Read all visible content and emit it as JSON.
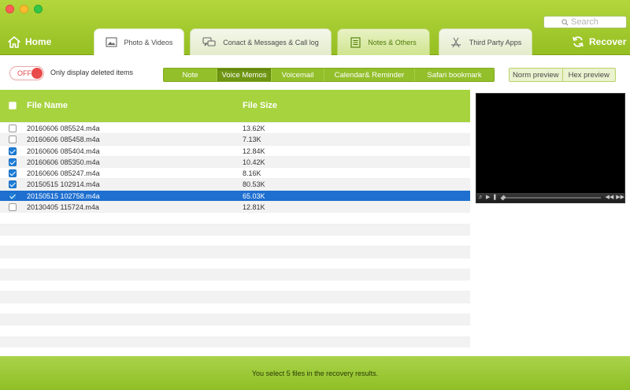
{
  "window": {
    "search_placeholder": "Search"
  },
  "nav": {
    "home_label": "Home",
    "recover_label": "Recover",
    "tabs": [
      {
        "label": "Photo & Videos",
        "icon": "image-icon"
      },
      {
        "label": "Conact & Messages & Call log",
        "icon": "chat-bubbles-icon"
      },
      {
        "label": "Notes & Others",
        "icon": "notes-icon"
      },
      {
        "label": "Third Party Apps",
        "icon": "app-store-icon"
      }
    ]
  },
  "filter": {
    "toggle_label": "OFF",
    "deleted_label": "Only display deleted items",
    "categories": [
      "Note",
      "Voice Memos",
      "Voicemail",
      "Calendar& Reminder",
      "Safari bookmark"
    ],
    "selected_category": "Voice Memos",
    "preview_modes": [
      "Norm preview",
      "Hex preview"
    ]
  },
  "table": {
    "headers": {
      "name": "File Name",
      "size": "File Size"
    },
    "rows": [
      {
        "name": "20160606 085524.m4a",
        "size": "13.62K",
        "checked": false
      },
      {
        "name": "20160606 085458.m4a",
        "size": "7.13K",
        "checked": false
      },
      {
        "name": "20160606 085404.m4a",
        "size": "12.84K",
        "checked": true
      },
      {
        "name": "20160606 085350.m4a",
        "size": "10.42K",
        "checked": true
      },
      {
        "name": "20160606 085247.m4a",
        "size": "8.16K",
        "checked": true
      },
      {
        "name": "20150515 102914.m4a",
        "size": "80.53K",
        "checked": true
      },
      {
        "name": "20150515 102758.m4a",
        "size": "65.03K",
        "checked": true
      },
      {
        "name": "20130405 115724.m4a",
        "size": "12.81K",
        "checked": false
      }
    ],
    "selected_row": 6
  },
  "status": {
    "text": "You select 5 files in the recovery results."
  },
  "colors": {
    "brand_green": "#a7d33f",
    "selection_blue": "#1e6fd0",
    "toggle_red": "#e94a4a"
  }
}
